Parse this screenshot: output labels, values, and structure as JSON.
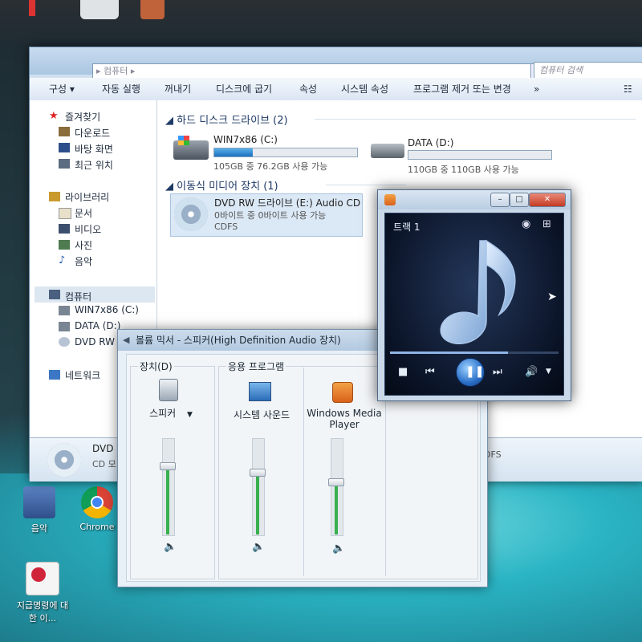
{
  "explorer": {
    "address_placeholder": "▸ 컴퓨터 ▸",
    "search_placeholder": "컴퓨터 검색",
    "toolbar": [
      "구성 ▾",
      "자동 실행",
      "꺼내기",
      "디스크에 굽기",
      "속성",
      "시스템 속성",
      "프로그램 제거 또는 변경",
      "»"
    ],
    "nav": {
      "favorites": "즐겨찾기",
      "favorites_items": [
        "다운로드",
        "바탕 화면",
        "최근 위치"
      ],
      "libraries": "라이브러리",
      "libraries_items": [
        "문서",
        "비디오",
        "사진",
        "음악"
      ],
      "computer": "컴퓨터",
      "computer_items": [
        "WIN7x86 (C:)",
        "DATA (D:)",
        "DVD RW"
      ],
      "network": "네트워크"
    },
    "hdd_group": "하드 디스크 드라이브 (2)",
    "drives": [
      {
        "name": "WIN7x86 (C:)",
        "space": "105GB 중 76.2GB 사용 가능",
        "used_fraction": 0.27
      },
      {
        "name": "DATA (D:)",
        "space": "110GB 중 110GB 사용 가능",
        "used_fraction": 0.0
      }
    ],
    "removable_group": "이동식 미디어 장치 (1)",
    "dvd": {
      "name": "DVD RW 드라이브 (E:) Audio CD",
      "space": "0바이트 중 0바이트 사용 가능",
      "fs": "CDFS"
    },
    "details": {
      "name": "DVD",
      "line2": "CD 모",
      "fs": "DFS"
    }
  },
  "mixer": {
    "title": "볼륨 믹서 - 스피커(High Definition Audio 장치)",
    "device_label": "장치(D)",
    "apps_label": "응용 프로그램",
    "channels": [
      {
        "name": "스피커",
        "level": 0.72
      },
      {
        "name": "시스템 사운드",
        "level": 0.65
      },
      {
        "name": "Windows Media Player",
        "level": 0.55
      }
    ]
  },
  "player": {
    "track": "트랙 1",
    "progress": 0.7,
    "buttons": {
      "minimize": "–",
      "maximize": "□",
      "close": "✕"
    }
  },
  "desktop": {
    "icons": [
      "음악",
      "Chrome",
      "지급명령에 대한 이..."
    ]
  }
}
